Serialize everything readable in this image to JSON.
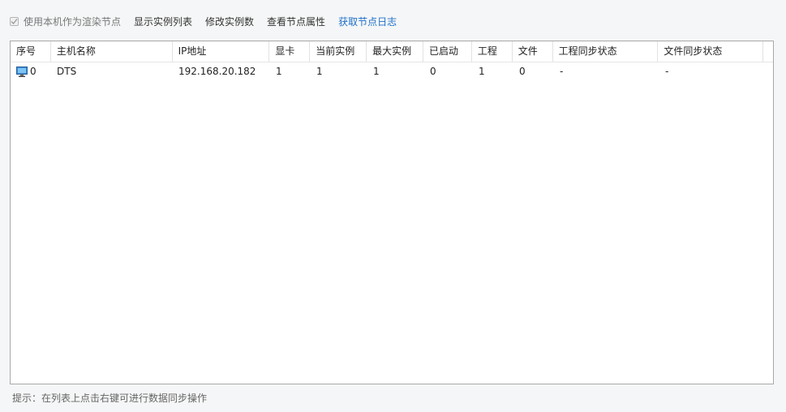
{
  "toolbar": {
    "use_local_label": "使用本机作为渲染节点",
    "use_local_checked": true,
    "show_instances": "显示实例列表",
    "modify_instances": "修改实例数",
    "view_properties": "查看节点属性",
    "get_logs": "获取节点日志"
  },
  "table": {
    "columns": [
      "序号",
      "主机名称",
      "IP地址",
      "显卡",
      "当前实例",
      "最大实例",
      "已启动",
      "工程",
      "文件",
      "工程同步状态",
      "文件同步状态"
    ],
    "rows": [
      {
        "index": "0",
        "icon": "computer-icon",
        "host": "DTS",
        "ip": "192.168.20.182",
        "gpu": "1",
        "current": "1",
        "max": "1",
        "started": "0",
        "project": "1",
        "file": "0",
        "project_sync": "-",
        "file_sync": "-"
      }
    ]
  },
  "hint": "提示：在列表上点击右键可进行数据同步操作",
  "colors": {
    "accent": "#1e70c8",
    "border": "#a9a9a9",
    "background": "#f5f6f7"
  }
}
